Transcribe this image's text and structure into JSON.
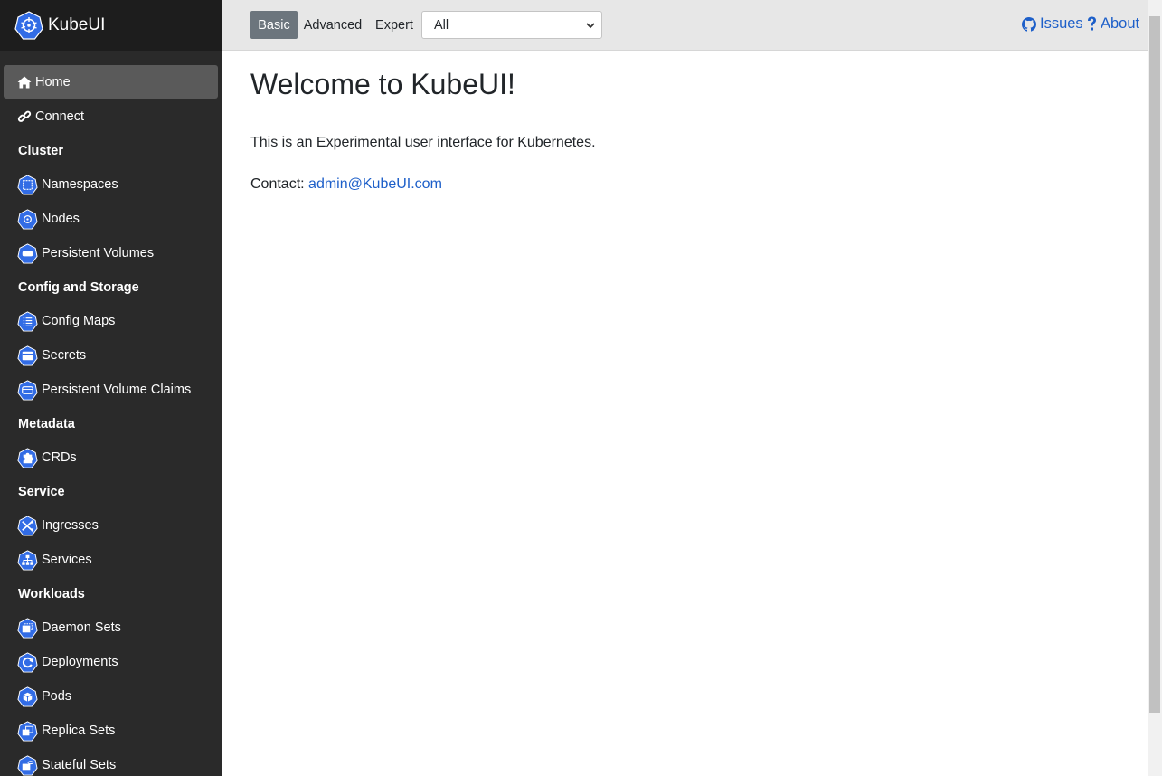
{
  "app": {
    "name": "KubeUI"
  },
  "topbar": {
    "levels": [
      {
        "label": "Basic",
        "active": true
      },
      {
        "label": "Advanced",
        "active": false
      },
      {
        "label": "Expert",
        "active": false
      }
    ],
    "namespace_select": {
      "value": "All"
    },
    "links": {
      "issues": "Issues",
      "about": "About"
    }
  },
  "sidebar": {
    "top_items": [
      {
        "label": "Home",
        "icon": "home-icon",
        "active": true
      },
      {
        "label": "Connect",
        "icon": "link-icon",
        "active": false
      }
    ],
    "sections": [
      {
        "heading": "Cluster",
        "items": [
          {
            "label": "Namespaces",
            "icon": "namespace-icon"
          },
          {
            "label": "Nodes",
            "icon": "node-icon"
          },
          {
            "label": "Persistent Volumes",
            "icon": "persistent-volume-icon"
          }
        ]
      },
      {
        "heading": "Config and Storage",
        "items": [
          {
            "label": "Config Maps",
            "icon": "config-map-icon"
          },
          {
            "label": "Secrets",
            "icon": "secret-icon"
          },
          {
            "label": "Persistent Volume Claims",
            "icon": "persistent-volume-claim-icon"
          }
        ]
      },
      {
        "heading": "Metadata",
        "items": [
          {
            "label": "CRDs",
            "icon": "crd-icon"
          }
        ]
      },
      {
        "heading": "Service",
        "items": [
          {
            "label": "Ingresses",
            "icon": "ingress-icon"
          },
          {
            "label": "Services",
            "icon": "service-icon"
          }
        ]
      },
      {
        "heading": "Workloads",
        "items": [
          {
            "label": "Daemon Sets",
            "icon": "daemon-set-icon"
          },
          {
            "label": "Deployments",
            "icon": "deployment-icon"
          },
          {
            "label": "Pods",
            "icon": "pod-icon"
          },
          {
            "label": "Replica Sets",
            "icon": "replica-set-icon"
          },
          {
            "label": "Stateful Sets",
            "icon": "stateful-set-icon"
          }
        ]
      }
    ]
  },
  "main": {
    "title": "Welcome to KubeUI!",
    "intro": "This is an Experimental user interface for Kubernetes.",
    "contact_label": "Contact:",
    "contact_email": "admin@KubeUI.com"
  },
  "colors": {
    "sidebar_bg": "#2a2a2a",
    "brand_bg": "#1d1d1d",
    "topbar_bg": "#e7e7e7",
    "link": "#1d5fc9",
    "k8s_blue": "#326ce5",
    "active_level": "#6c757d"
  }
}
